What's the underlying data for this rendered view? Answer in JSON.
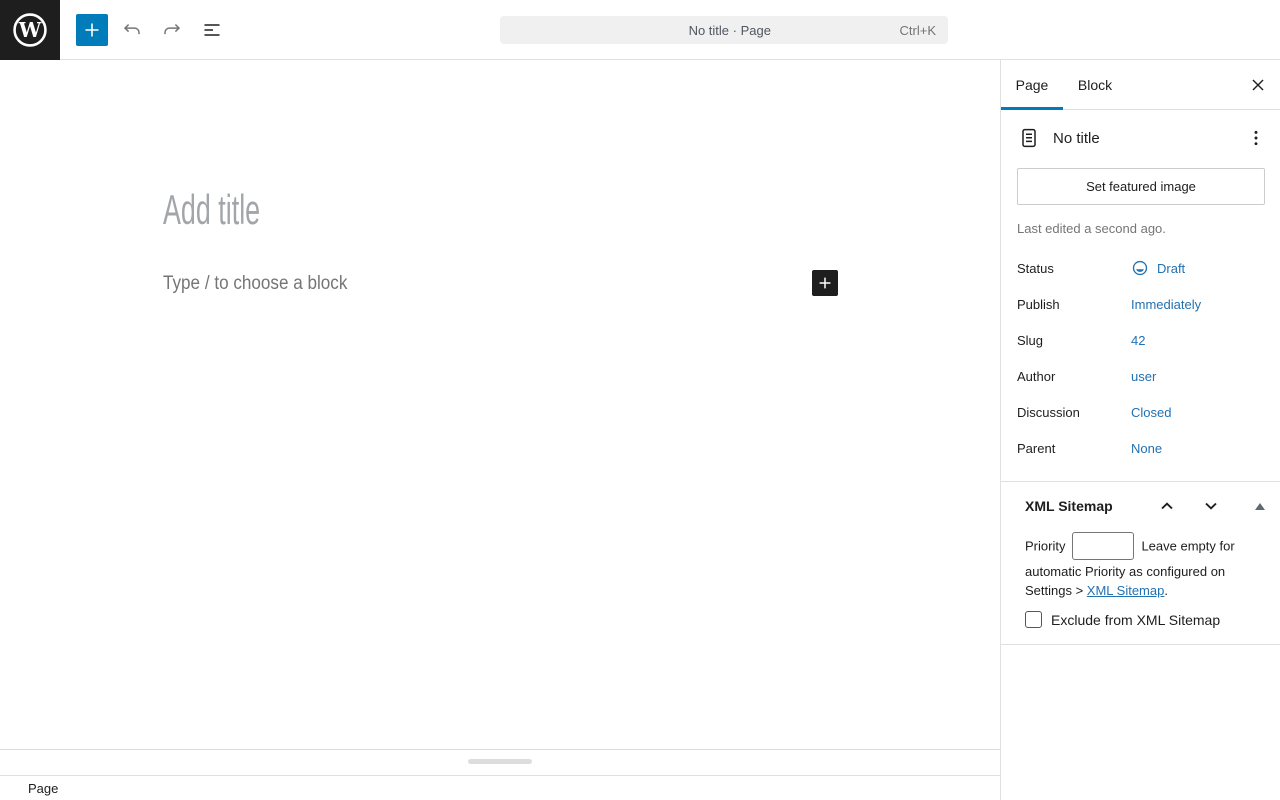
{
  "header": {
    "command_bar": {
      "title": "No title · Page",
      "shortcut": "Ctrl+K"
    }
  },
  "editor": {
    "title_placeholder": "Add title",
    "block_placeholder": "Type / to choose a block"
  },
  "footer": {
    "breadcrumb": "Page"
  },
  "sidebar": {
    "tabs": [
      {
        "label": "Page"
      },
      {
        "label": "Block"
      }
    ],
    "document": {
      "title": "No title"
    },
    "featured_image_button": "Set featured image",
    "last_edited": "Last edited a second ago.",
    "summary_rows": [
      {
        "label": "Status",
        "value": "Draft"
      },
      {
        "label": "Publish",
        "value": "Immediately"
      },
      {
        "label": "Slug",
        "value": "42"
      },
      {
        "label": "Author",
        "value": "user"
      },
      {
        "label": "Discussion",
        "value": "Closed"
      },
      {
        "label": "Parent",
        "value": "None"
      }
    ],
    "xml_sitemap_panel": {
      "title": "XML Sitemap",
      "priority_label": "Priority",
      "priority_value": "",
      "help_text_before_link": "Leave empty for automatic Priority as configured on Settings > ",
      "help_link": "XML Sitemap",
      "help_text_after_link": ".",
      "checkbox_label": "Exclude from XML Sitemap"
    }
  },
  "icons": {
    "wordpress_logo_glyph": "W",
    "inserter": "plus-icon",
    "undo": "undo-arrow-icon",
    "redo": "redo-arrow-icon",
    "document_overview": "list-view-icon",
    "close": "close-icon",
    "kebab": "ellipsis-vertical-icon",
    "page_document": "document-icon",
    "draft_status": "half-filled-circle-icon",
    "panel_open": "triangle-up-icon"
  },
  "colors": {
    "accent_blue": "#007cba",
    "link_blue": "#2271b1",
    "dark": "#1e1e1e",
    "muted": "#757575",
    "border": "#e0e0e0",
    "command_bar_bg": "#f0f0f0"
  }
}
